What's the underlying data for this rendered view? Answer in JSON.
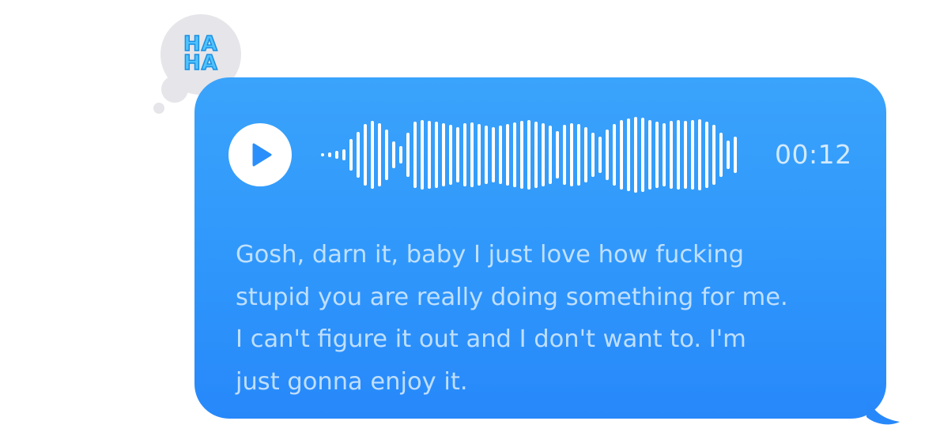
{
  "reaction": {
    "icon": "haha-icon",
    "line1": "HA",
    "line2": "HA",
    "color": "#4fc3ff"
  },
  "audio_message": {
    "duration": "00:12",
    "progress": 0,
    "bubble_color": "#2f97fb",
    "transcript": "Gosh, darn it, baby I just love how fucking\nstupid you are really doing something for me.\nI can't figure it out and I don't want to. I'm\njust gonna enjoy it."
  }
}
